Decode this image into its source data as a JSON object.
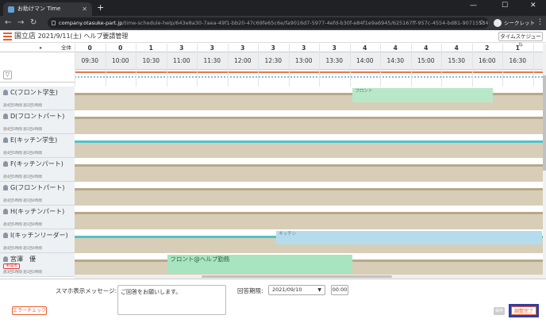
{
  "browser": {
    "tab_title": "お助けマン Time",
    "url_host": "company.otasuke-part.jp",
    "url_path": "/time-schedule-help/643e8a30-7aea-49f1-bb20-47c69fe65c6e/fa9016d7-5977-4efd-b30f-e84f1e9a6945/625167ff-957c-4554-bd81-90715534f199/1631286000...",
    "incognito_label": "シークレット"
  },
  "header": {
    "store": "国立店",
    "title": "2021/9/11(土) ヘルプ要請管理",
    "timeschedule_button": "タイムスケジュール"
  },
  "grid": {
    "all_label": "全体",
    "counts": [
      "0",
      "0",
      "1",
      "3",
      "3",
      "3",
      "3",
      "3",
      "3",
      "4",
      "4",
      "4",
      "4",
      "2",
      "1"
    ],
    "times": [
      "09:30",
      "10:00",
      "10:30",
      "11:00",
      "11:30",
      "12:00",
      "12:30",
      "13:00",
      "13:30",
      "14:00",
      "14:30",
      "15:00",
      "15:30",
      "16:00",
      "16:30"
    ]
  },
  "employees": [
    {
      "name": "C(フロント学生)",
      "sub": "週4回5時間 週2回5時間",
      "shift_label": "フロント"
    },
    {
      "name": "D(フロントパート)",
      "sub": "週4回5時間 週1回4時間",
      "shift_label": ""
    },
    {
      "name": "E(キッチン学生)",
      "sub": "週4回5時間 週1回4時間",
      "shift_label": ""
    },
    {
      "name": "F(キッチンパート)",
      "sub": "週4回5時間 週1回4時間",
      "shift_label": ""
    },
    {
      "name": "G(フロントパート)",
      "sub": "週4回5時間 週1回4時間",
      "shift_label": ""
    },
    {
      "name": "H(キッチンパート)",
      "sub": "週4回5時間 週1回4時間",
      "shift_label": ""
    },
    {
      "name": "I(キッチンリーダー)",
      "sub": "週4回5時間 週1回4時間",
      "shift_label": "キッチン"
    },
    {
      "name": "宮澤　優",
      "badge": "未提出",
      "sub": "週3回5時間 週1回3時間",
      "shift_label": "フロント@ヘルプ勤務"
    }
  ],
  "footer": {
    "message_label": "スマホ表示メッセージ:",
    "message_value": "ご回答をお願いします。",
    "deadline_label": "回答期限:",
    "deadline_date": "2021/09/10",
    "deadline_time": "00:00",
    "error_check_button": "エラーチェック",
    "save_button": "保存",
    "done_button": "調整完了"
  },
  "colors": {
    "accent": "#e85d2c",
    "help_shift": "#a8e4bf",
    "kitchen_shift": "#b5dced",
    "done_border": "#2c3ea8"
  }
}
